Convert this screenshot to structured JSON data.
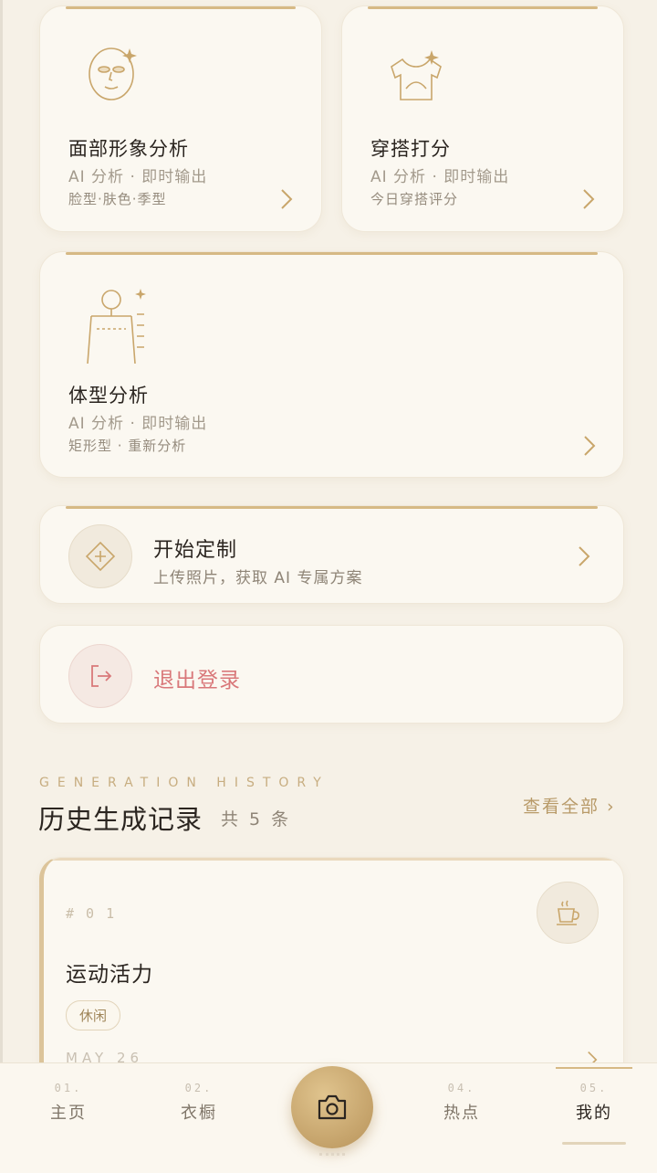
{
  "cards": {
    "face": {
      "title": "面部形象分析",
      "sub": "AI 分析 · 即时输出",
      "tag": "脸型·肤色·季型",
      "icon": "face-sparkle-icon"
    },
    "outfit": {
      "title": "穿搭打分",
      "sub": "AI 分析 · 即时输出",
      "tag": "今日穿搭评分",
      "icon": "shirt-sparkle-icon"
    },
    "body": {
      "title": "体型分析",
      "sub": "AI 分析 · 即时输出",
      "tag": "矩形型 · 重新分析",
      "icon": "body-figure-icon"
    }
  },
  "customize": {
    "title": "开始定制",
    "sub": "上传照片，获取 AI 专属方案",
    "icon": "diamond-plus-icon"
  },
  "logout": {
    "label": "退出登录",
    "icon": "logout-icon"
  },
  "history": {
    "eyebrow": "GENERATION HISTORY",
    "title": "历史生成记录",
    "count": "共 5 条",
    "see_all": "查看全部 ›",
    "items": [
      {
        "index": "# 0 1",
        "title": "运动活力",
        "tag": "休闲",
        "date": "MAY 26",
        "icon": "coffee-cup-icon"
      }
    ]
  },
  "nav": {
    "items": [
      {
        "num": "01.",
        "label": "主页"
      },
      {
        "num": "02.",
        "label": "衣橱"
      },
      {
        "num": "04.",
        "label": "热点"
      },
      {
        "num": "05.",
        "label": "我的"
      }
    ],
    "camera_icon": "camera-icon"
  },
  "colors": {
    "accent": "#c9a66b",
    "danger": "#d9787a",
    "background": "#f6f1e7"
  }
}
